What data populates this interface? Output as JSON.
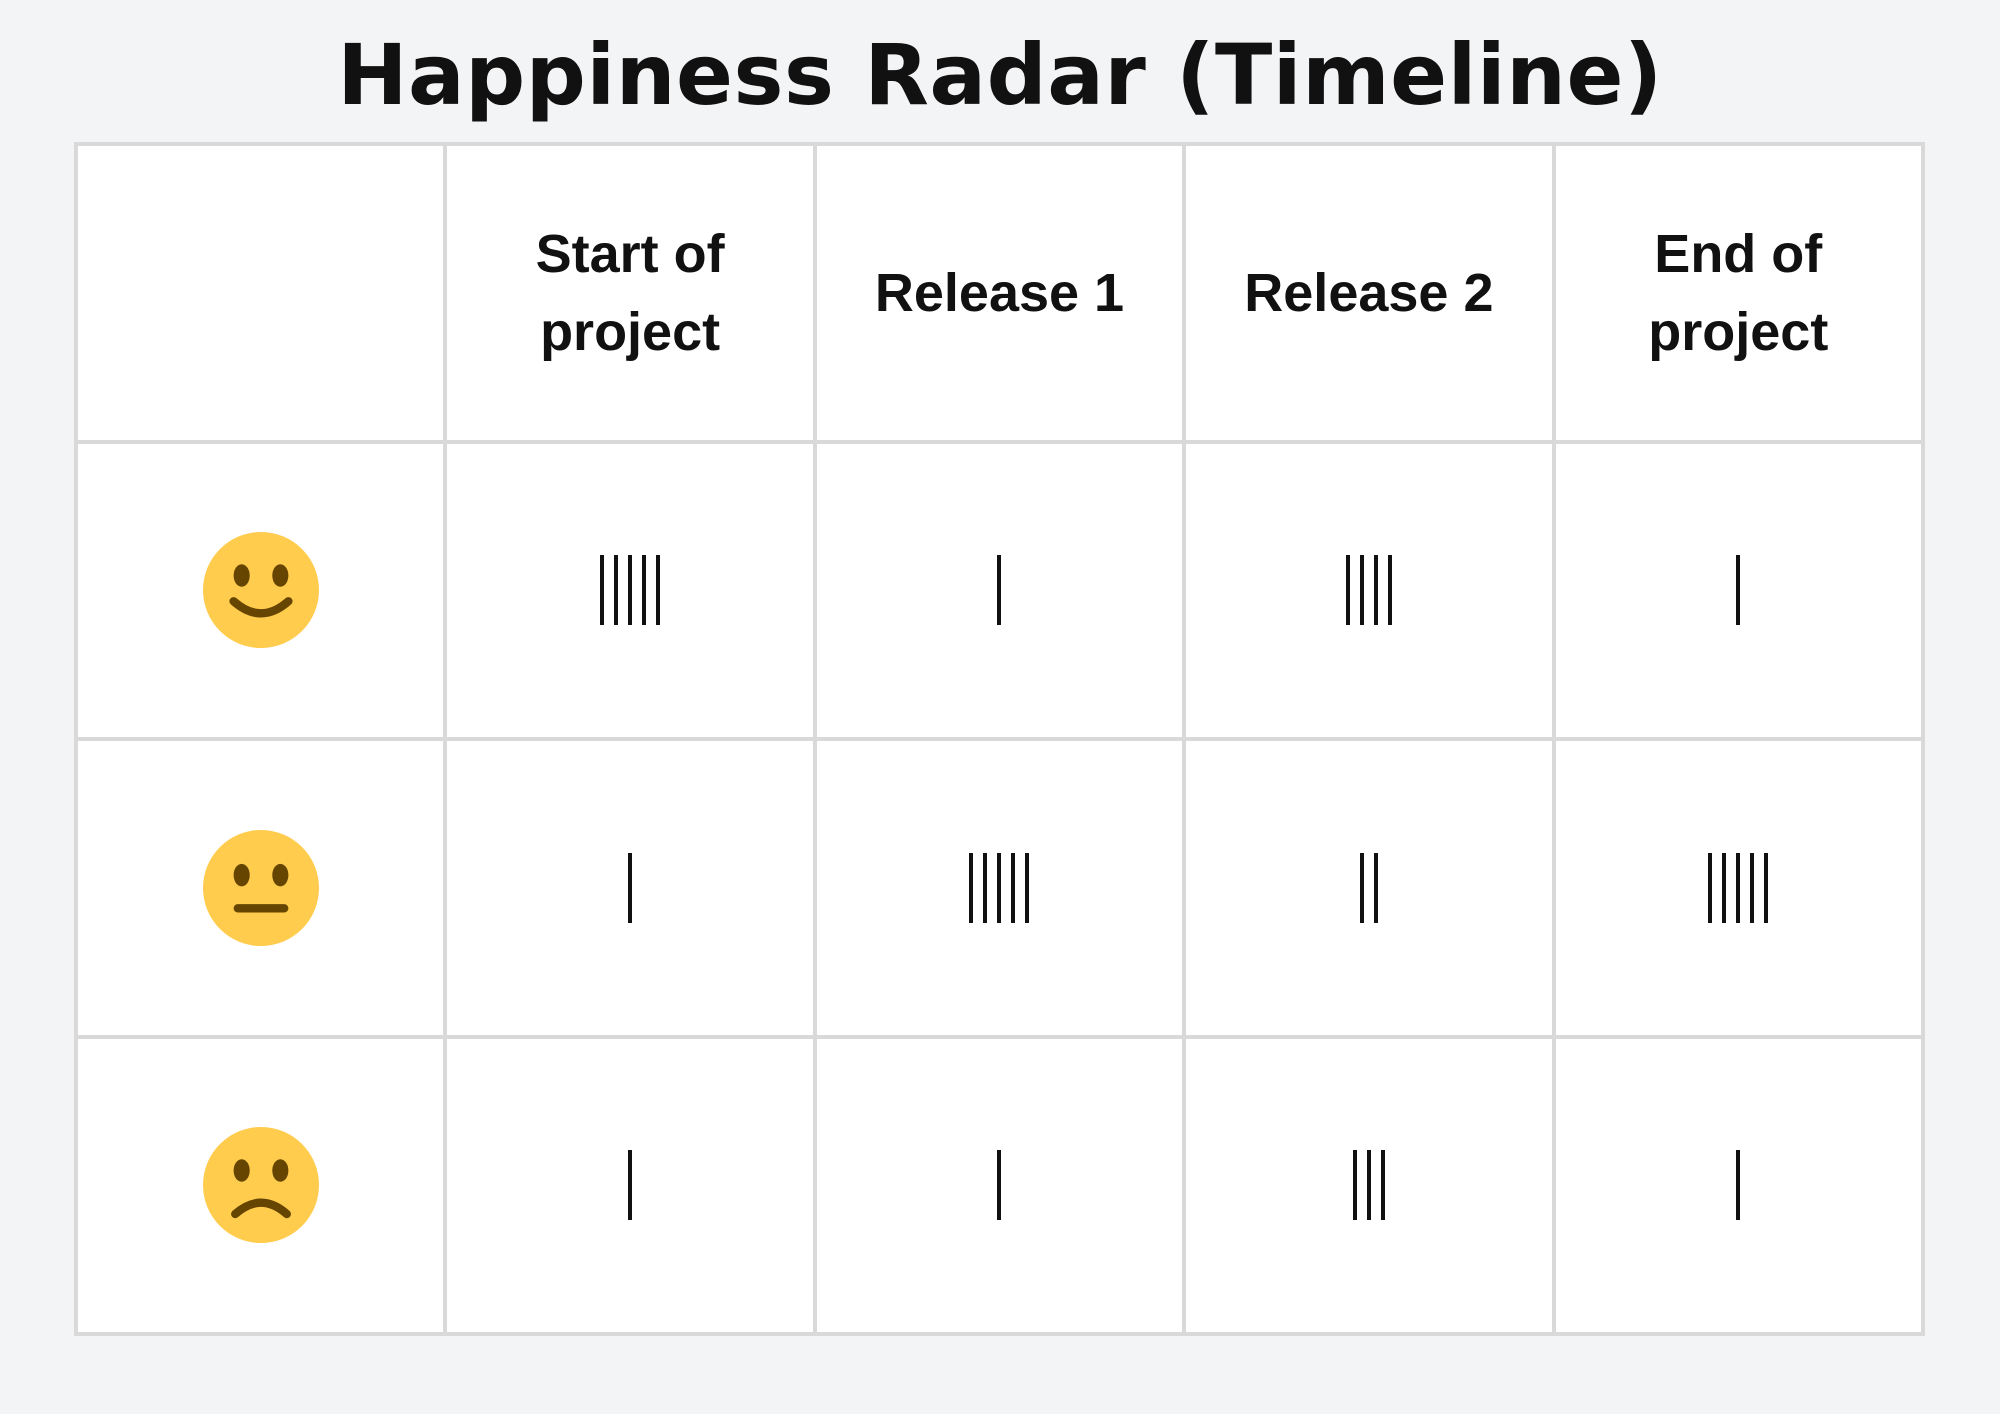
{
  "title": "Happiness Radar (Timeline)",
  "chart_data": {
    "type": "table",
    "title": "Happiness Radar (Timeline)",
    "columns": [
      "Start of project",
      "Release 1",
      "Release 2",
      "End of project"
    ],
    "rows": [
      {
        "mood": "happy",
        "icon": "slightly-smiling-face-icon",
        "tallies": [
          5,
          1,
          4,
          1
        ]
      },
      {
        "mood": "neutral",
        "icon": "neutral-face-icon",
        "tallies": [
          1,
          5,
          2,
          5
        ]
      },
      {
        "mood": "sad",
        "icon": "slightly-frowning-face-icon",
        "tallies": [
          1,
          1,
          3,
          1
        ]
      }
    ]
  },
  "colors": {
    "face": "#ffcc4d",
    "face_features": "#664500",
    "grid_line": "#d9d9d9",
    "background": "#f3f4f6",
    "text": "#111111"
  }
}
